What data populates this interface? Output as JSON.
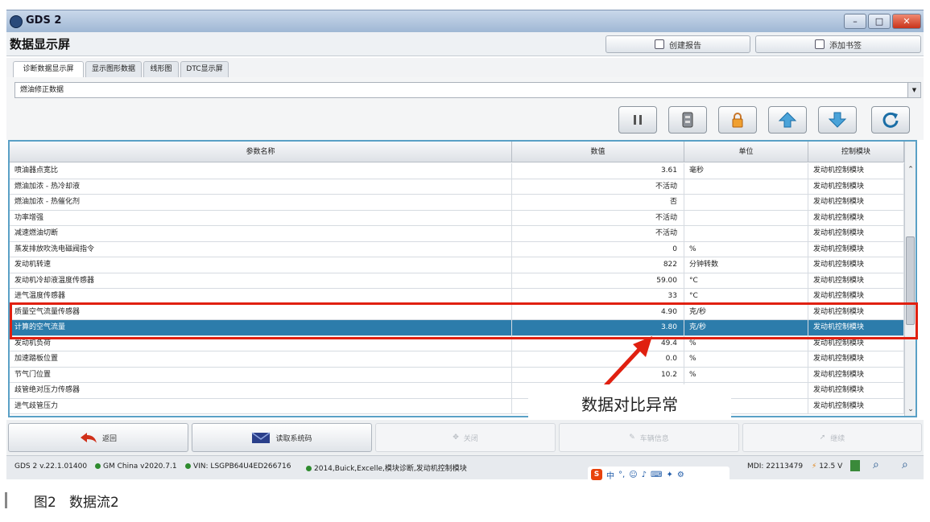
{
  "window": {
    "app_title": "GDS 2",
    "controls": {
      "minimize": "–",
      "maximize": "□",
      "close": "✕"
    }
  },
  "header": {
    "page_title": "数据显示屏",
    "create_report_label": "创建报告",
    "add_bookmark_label": "添加书签"
  },
  "tabs": [
    {
      "label": "诊断数据显示屏"
    },
    {
      "label": "显示图形数据"
    },
    {
      "label": "线形图"
    },
    {
      "label": "DTC显示屏"
    }
  ],
  "dataset_selector": {
    "value": "燃油修正数据"
  },
  "table": {
    "columns": [
      "参数名称",
      "数值",
      "单位",
      "控制模块"
    ],
    "rows": [
      {
        "name": "喷油器点宽比",
        "value": "3.61",
        "unit": "毫秒",
        "module": "发动机控制模块"
      },
      {
        "name": "燃油加浓 - 热冷却液",
        "value": "不活动",
        "unit": "",
        "module": "发动机控制模块"
      },
      {
        "name": "燃油加浓 - 热催化剂",
        "value": "否",
        "unit": "",
        "module": "发动机控制模块"
      },
      {
        "name": "功率增强",
        "value": "不活动",
        "unit": "",
        "module": "发动机控制模块"
      },
      {
        "name": "减速燃油切断",
        "value": "不活动",
        "unit": "",
        "module": "发动机控制模块"
      },
      {
        "name": "蒸发排放吹洗电磁阀指令",
        "value": "0",
        "unit": "%",
        "module": "发动机控制模块"
      },
      {
        "name": "发动机转速",
        "value": "822",
        "unit": "分钟转数",
        "module": "发动机控制模块"
      },
      {
        "name": "发动机冷却液温度传感器",
        "value": "59.00",
        "unit": "°C",
        "module": "发动机控制模块"
      },
      {
        "name": "进气温度传感器",
        "value": "33",
        "unit": "°C",
        "module": "发动机控制模块"
      },
      {
        "name": "质量空气流量传感器",
        "value": "4.90",
        "unit": "克/秒",
        "module": "发动机控制模块"
      },
      {
        "name": "计算的空气流量",
        "value": "3.80",
        "unit": "克/秒",
        "module": "发动机控制模块",
        "selected": true
      },
      {
        "name": "发动机负荷",
        "value": "49.4",
        "unit": "%",
        "module": "发动机控制模块"
      },
      {
        "name": "加速踏板位置",
        "value": "0.0",
        "unit": "%",
        "module": "发动机控制模块"
      },
      {
        "name": "节气门位置",
        "value": "10.2",
        "unit": "%",
        "module": "发动机控制模块"
      },
      {
        "name": "歧管绝对压力传感器",
        "value": "",
        "unit": "",
        "module": "发动机控制模块"
      },
      {
        "name": "进气歧管压力",
        "value": "",
        "unit": "",
        "module": "发动机控制模块"
      }
    ]
  },
  "annotation": {
    "text": "数据对比异常"
  },
  "bottom_buttons": [
    {
      "label": "返回",
      "enabled": true
    },
    {
      "label": "读取系统码",
      "enabled": true
    },
    {
      "label": "关闭",
      "enabled": false
    },
    {
      "label": "车辆信息",
      "enabled": false
    },
    {
      "label": "继续",
      "enabled": false
    }
  ],
  "status": {
    "version": "GDS 2 v.22.1.01400",
    "gm_region": "GM China v2020.7.1",
    "vin": "VIN: LSGPB64U4ED266716",
    "vehicle": "2014,Buick,Excelle,模块诊断,发动机控制模块",
    "mdi": "MDI: 22113479",
    "voltage": "12.5 V"
  },
  "ime": {
    "logo": "S",
    "lang": "中"
  },
  "caption": {
    "figure": "图2",
    "title": "数据流2"
  },
  "colors": {
    "selection": "#2c7cab",
    "highlight": "#e02010",
    "frame": "#5aa0c6"
  }
}
